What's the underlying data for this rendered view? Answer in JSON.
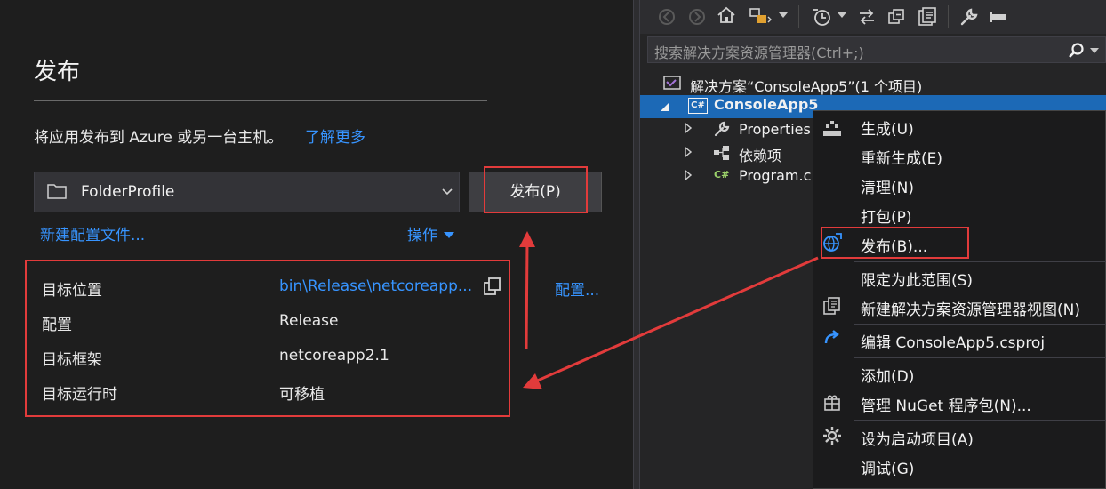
{
  "publish": {
    "title": "发布",
    "description": "将应用发布到 Azure 或另一台主机。",
    "learn_more": "了解更多",
    "profile": "FolderProfile",
    "publish_button": "发布(P)",
    "new_profile": "新建配置文件...",
    "actions": "操作",
    "configure": "配置...",
    "settings": [
      {
        "label": "目标位置",
        "value": "bin\\Release\\netcoreapp..."
      },
      {
        "label": "配置",
        "value": "Release"
      },
      {
        "label": "目标框架",
        "value": "netcoreapp2.1"
      },
      {
        "label": "目标运行时",
        "value": "可移植"
      }
    ]
  },
  "explorer": {
    "search_placeholder": "搜索解决方案资源管理器(Ctrl+;)",
    "solution": "解决方案“ConsoleApp5”(1 个项目)",
    "project": "ConsoleApp5",
    "project_badge": "C#",
    "children": [
      "Properties",
      "依赖项",
      "Program.c"
    ],
    "child_badge": "C#"
  },
  "context_menu": {
    "items": [
      "生成(U)",
      "重新生成(E)",
      "清理(N)",
      "打包(P)",
      "发布(B)...",
      "限定为此范围(S)",
      "新建解决方案资源管理器视图(N)",
      "编辑 ConsoleApp5.csproj",
      "添加(D)",
      "管理 NuGet 程序包(N)...",
      "设为启动项目(A)",
      "调试(G)"
    ]
  },
  "colors": {
    "accent": "#3794ff",
    "highlight_box": "#e23b3b",
    "selection": "#1c69b6"
  }
}
